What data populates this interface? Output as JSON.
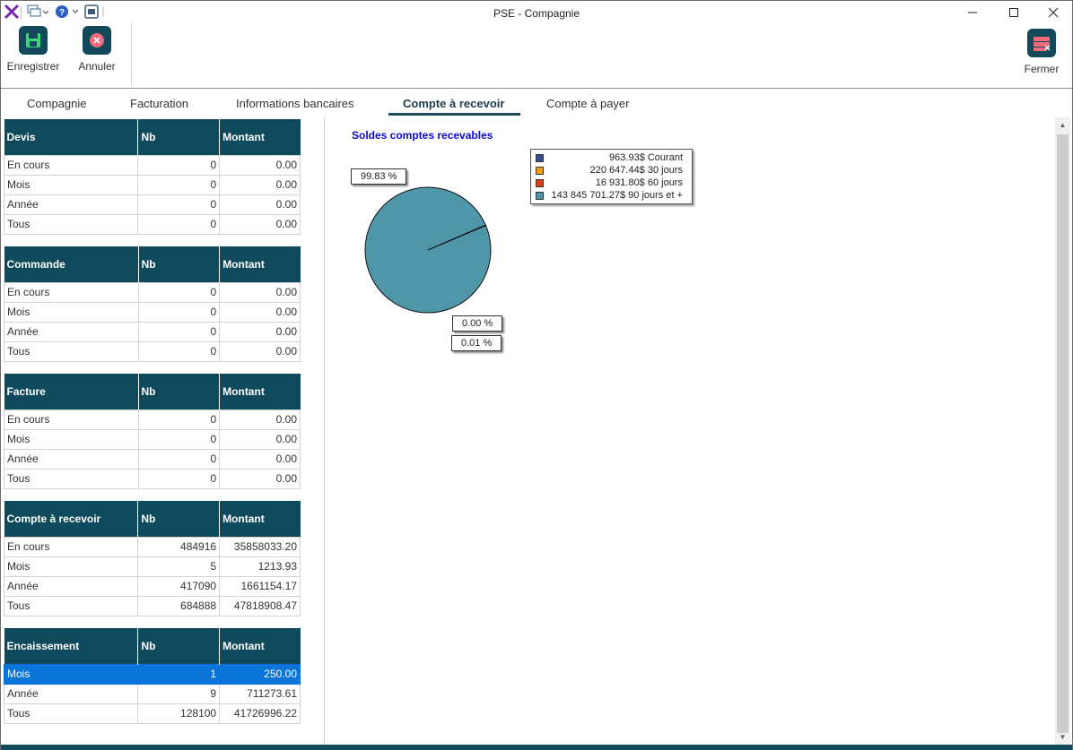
{
  "window": {
    "title": "PSE - Compagnie"
  },
  "ribbon": {
    "save_label": "Enregistrer",
    "cancel_label": "Annuler",
    "close_label": "Fermer"
  },
  "tabs": [
    {
      "label": "Compagnie"
    },
    {
      "label": "Facturation"
    },
    {
      "label": "Informations bancaires"
    },
    {
      "label": "Compte à recevoir",
      "active": true
    },
    {
      "label": "Compte à payer"
    }
  ],
  "tables": [
    {
      "header": "Devis",
      "col_nb": "Nb",
      "col_montant": "Montant",
      "rows": [
        [
          "En cours",
          "0",
          "0.00"
        ],
        [
          "Mois",
          "0",
          "0.00"
        ],
        [
          "Année",
          "0",
          "0.00"
        ],
        [
          "Tous",
          "0",
          "0.00"
        ]
      ]
    },
    {
      "header": "Commande",
      "col_nb": "Nb",
      "col_montant": "Montant",
      "rows": [
        [
          "En cours",
          "0",
          "0.00"
        ],
        [
          "Mois",
          "0",
          "0.00"
        ],
        [
          "Année",
          "0",
          "0.00"
        ],
        [
          "Tous",
          "0",
          "0.00"
        ]
      ]
    },
    {
      "header": "Facture",
      "col_nb": "Nb",
      "col_montant": "Montant",
      "rows": [
        [
          "En cours",
          "0",
          "0.00"
        ],
        [
          "Mois",
          "0",
          "0.00"
        ],
        [
          "Année",
          "0",
          "0.00"
        ],
        [
          "Tous",
          "0",
          "0.00"
        ]
      ]
    },
    {
      "header": "Compte à recevoir",
      "col_nb": "Nb",
      "col_montant": "Montant",
      "rows": [
        [
          "En cours",
          "484916",
          "35858033.20"
        ],
        [
          "Mois",
          "5",
          "1213.93"
        ],
        [
          "Année",
          "417090",
          "1661154.17"
        ],
        [
          "Tous",
          "684888",
          "47818908.47"
        ]
      ]
    },
    {
      "header": "Encaissement",
      "col_nb": "Nb",
      "col_montant": "Montant",
      "rows": [
        [
          "Mois",
          "1",
          "250.00"
        ],
        [
          "Année",
          "9",
          "711273.61"
        ],
        [
          "Tous",
          "128100",
          "41726996.22"
        ]
      ],
      "selected_row": 0
    }
  ],
  "chart_data": {
    "type": "pie",
    "title": "Soldes comptes recevables",
    "series": [
      {
        "name": "963.93$ Courant",
        "value": 963.93,
        "color": "#3b4f8f"
      },
      {
        "name": "220 647.44$ 30 jours",
        "value": 220647.44,
        "color": "#f0a020"
      },
      {
        "name": "16 931.80$ 60 jours",
        "value": 16931.8,
        "color": "#d8401c"
      },
      {
        "name": "143 845 701.27$ 90 jours et +",
        "value": 143845701.27,
        "color": "#4f97a8"
      }
    ],
    "data_labels": [
      "99.83 %",
      "0.00 %",
      "0.01 %"
    ],
    "legend": "top-right"
  },
  "colors": {
    "header_bg": "#0f4a5c",
    "selection": "#0a74d8",
    "accent": "#124a5c"
  }
}
